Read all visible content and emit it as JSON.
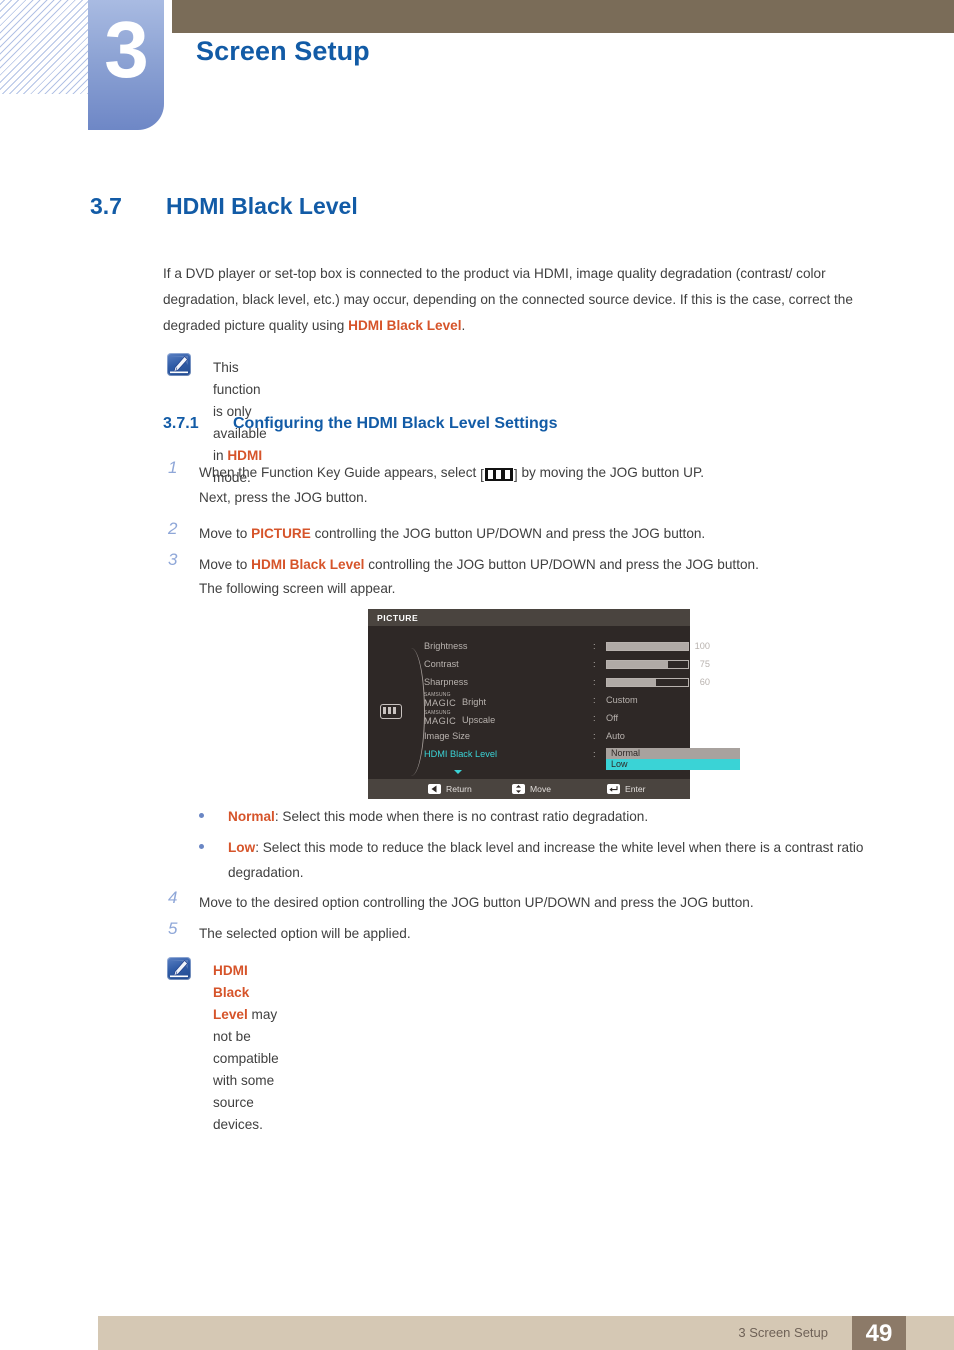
{
  "chapter": {
    "number": "3",
    "title": "Screen Setup"
  },
  "section": {
    "number": "3.7",
    "title": "HDMI Black Level"
  },
  "intro": {
    "part1": "If a DVD player or set-top box is connected to the product via HDMI, image quality degradation (contrast/ color degradation, black level, etc.) may occur, depending on the connected source device. If this is the case, correct the degraded picture quality using ",
    "highlight": "HDMI Black Level",
    "part2": "."
  },
  "note_top": {
    "icon": "note-pencil-icon",
    "part1": "This function is only available in ",
    "highlight": "HDMI",
    "part2": " mode."
  },
  "subsection": {
    "number": "3.7.1",
    "title": "Configuring the HDMI Black Level Settings"
  },
  "steps": [
    {
      "number": "1",
      "pre": "When the Function Key Guide appears, select ",
      "icon": "picture-menu-key-icon",
      "post": " by moving the JOG button UP.",
      "line2": "Next, press the JOG button."
    },
    {
      "number": "2",
      "pre": "Move to ",
      "highlight": "PICTURE",
      "post": " controlling the JOG button UP/DOWN and press the JOG button."
    },
    {
      "number": "3",
      "pre": "Move to ",
      "highlight": "HDMI Black Level",
      "post": " controlling the JOG button UP/DOWN and press the JOG button.",
      "line2": "The following screen will appear."
    },
    {
      "number": "4",
      "pre": "Move to the desired option controlling the JOG button UP/DOWN and press the JOG button."
    },
    {
      "number": "5",
      "pre": "The selected option will be applied."
    }
  ],
  "osd": {
    "title": "PICTURE",
    "menu_icon": "picture-bars-icon",
    "rows": [
      {
        "label": "Brightness",
        "colon": ":",
        "type": "slider",
        "percent": 100,
        "value": "100"
      },
      {
        "label": "Contrast",
        "colon": ":",
        "type": "slider",
        "percent": 75,
        "value": "75"
      },
      {
        "label": "Sharpness",
        "colon": ":",
        "type": "slider",
        "percent": 60,
        "value": "60"
      },
      {
        "label_small": "SAMSUNG",
        "label_big": "MAGIC",
        "label_word": "Bright",
        "colon": ":",
        "type": "value",
        "value": "Custom"
      },
      {
        "label_small": "SAMSUNG",
        "label_big": "MAGIC",
        "label_word": "Upscale",
        "colon": ":",
        "type": "value",
        "value": "Off"
      },
      {
        "label": "Image Size",
        "colon": ":",
        "type": "value",
        "value": "Auto"
      },
      {
        "label": "HDMI Black Level",
        "colon": ":",
        "type": "submenu",
        "active": true,
        "options": [
          {
            "label": "Normal",
            "state": "unselected"
          },
          {
            "label": "Low",
            "state": "highlighted"
          }
        ]
      }
    ],
    "footer": [
      {
        "icon": "return-arrow-icon",
        "label": "Return"
      },
      {
        "icon": "move-updown-icon",
        "label": "Move"
      },
      {
        "icon": "enter-key-icon",
        "label": "Enter"
      }
    ],
    "colors": {
      "panel": "#2e2826",
      "bar": "#4a443f",
      "accent_cyan": "#3ad3d6",
      "option_gray": "#a8a29e"
    }
  },
  "bullets": [
    {
      "highlight": "Normal",
      "text": ": Select this mode when there is no contrast ratio degradation."
    },
    {
      "highlight": "Low",
      "text": ": Select this mode to reduce the black level and increase the white level when there is a contrast ratio degradation."
    }
  ],
  "note_bottom": {
    "icon": "note-pencil-icon",
    "highlight": "HDMI Black Level",
    "text": " may not be compatible with some source devices."
  },
  "footer": {
    "label": "3 Screen Setup",
    "page": "49"
  },
  "colors": {
    "heading_blue": "#125ba6",
    "accent_orange": "#d6542a",
    "chapter_tab": "#8da3d4",
    "top_band": "#7a6c58",
    "footer_bar": "#d5c8b4",
    "footer_page_box": "#8c7a68"
  }
}
